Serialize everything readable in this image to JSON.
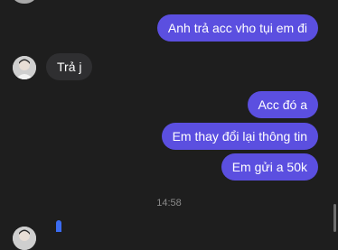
{
  "messages": [
    {
      "id": "m1",
      "direction": "outgoing",
      "text": "Anh trả acc vho tụi em đi"
    },
    {
      "id": "m2",
      "direction": "incoming",
      "text": "Trả j"
    },
    {
      "id": "m3",
      "direction": "outgoing",
      "text": "Acc đó a"
    },
    {
      "id": "m4",
      "direction": "outgoing",
      "text": "Em thay đổi lại thông tin"
    },
    {
      "id": "m5",
      "direction": "outgoing",
      "text": "Em gửi a 50k"
    }
  ],
  "timestamp": "14:58",
  "colors": {
    "background": "#1e1e1e",
    "outgoing_bubble": "#5b4fe0",
    "incoming_bubble": "#2f2f31",
    "timestamp_text": "#8a8a8a"
  }
}
